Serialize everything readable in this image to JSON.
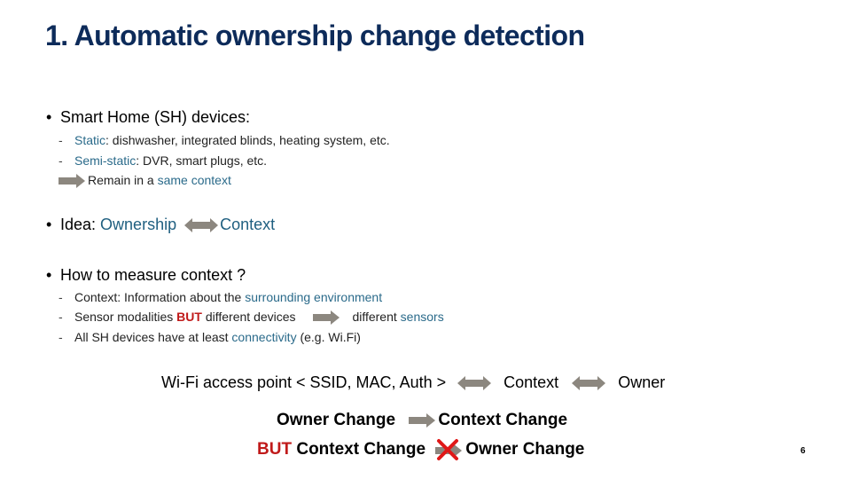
{
  "slide": {
    "title": "1. Automatic ownership change detection",
    "page_number": "6",
    "colors": {
      "title": "#0d2b5a",
      "highlight": "#2a6a8a",
      "emphasis_red": "#c01a1a",
      "arrow_gray": "#8c877f"
    }
  },
  "section1": {
    "bullet": "•",
    "heading": "Smart Home (SH) devices:",
    "items": [
      {
        "dash": "-",
        "label": "Static",
        "text": ": dishwasher, integrated blinds, heating system, etc."
      },
      {
        "dash": "-",
        "label": "Semi-static",
        "text": ": DVR, smart plugs, etc."
      }
    ],
    "conclusion_prefix": "Remain in a ",
    "conclusion_highlight": "same context"
  },
  "section2": {
    "bullet": "•",
    "prefix": "Idea: ",
    "left": "Ownership",
    "right": "Context"
  },
  "section3": {
    "bullet": "•",
    "heading": "How to measure context ?",
    "item1": {
      "dash": "-",
      "text": "Context: Information about the ",
      "highlight": "surrounding environment"
    },
    "item2": {
      "dash": "-",
      "text1": "Sensor modalities ",
      "emph": "BUT",
      "text2": " different devices",
      "text3": "different ",
      "highlight": "sensors"
    },
    "item3": {
      "dash": "-",
      "text1": "All SH devices have at least ",
      "highlight": "connectivity",
      "text2": " (e.g. Wi.Fi)"
    }
  },
  "relation": {
    "source": "Wi-Fi access point < SSID, MAC, Auth >",
    "middle": "Context",
    "end": "Owner"
  },
  "conclusion": {
    "line1_left": "Owner Change",
    "line1_right": "Context Change",
    "line2_emph": "BUT",
    "line2_left": " Context Change",
    "line2_right": "Owner Change"
  },
  "icons": {
    "right_arrow": "right-arrow-icon",
    "double_arrow": "double-arrow-icon",
    "cross": "red-cross-icon"
  }
}
